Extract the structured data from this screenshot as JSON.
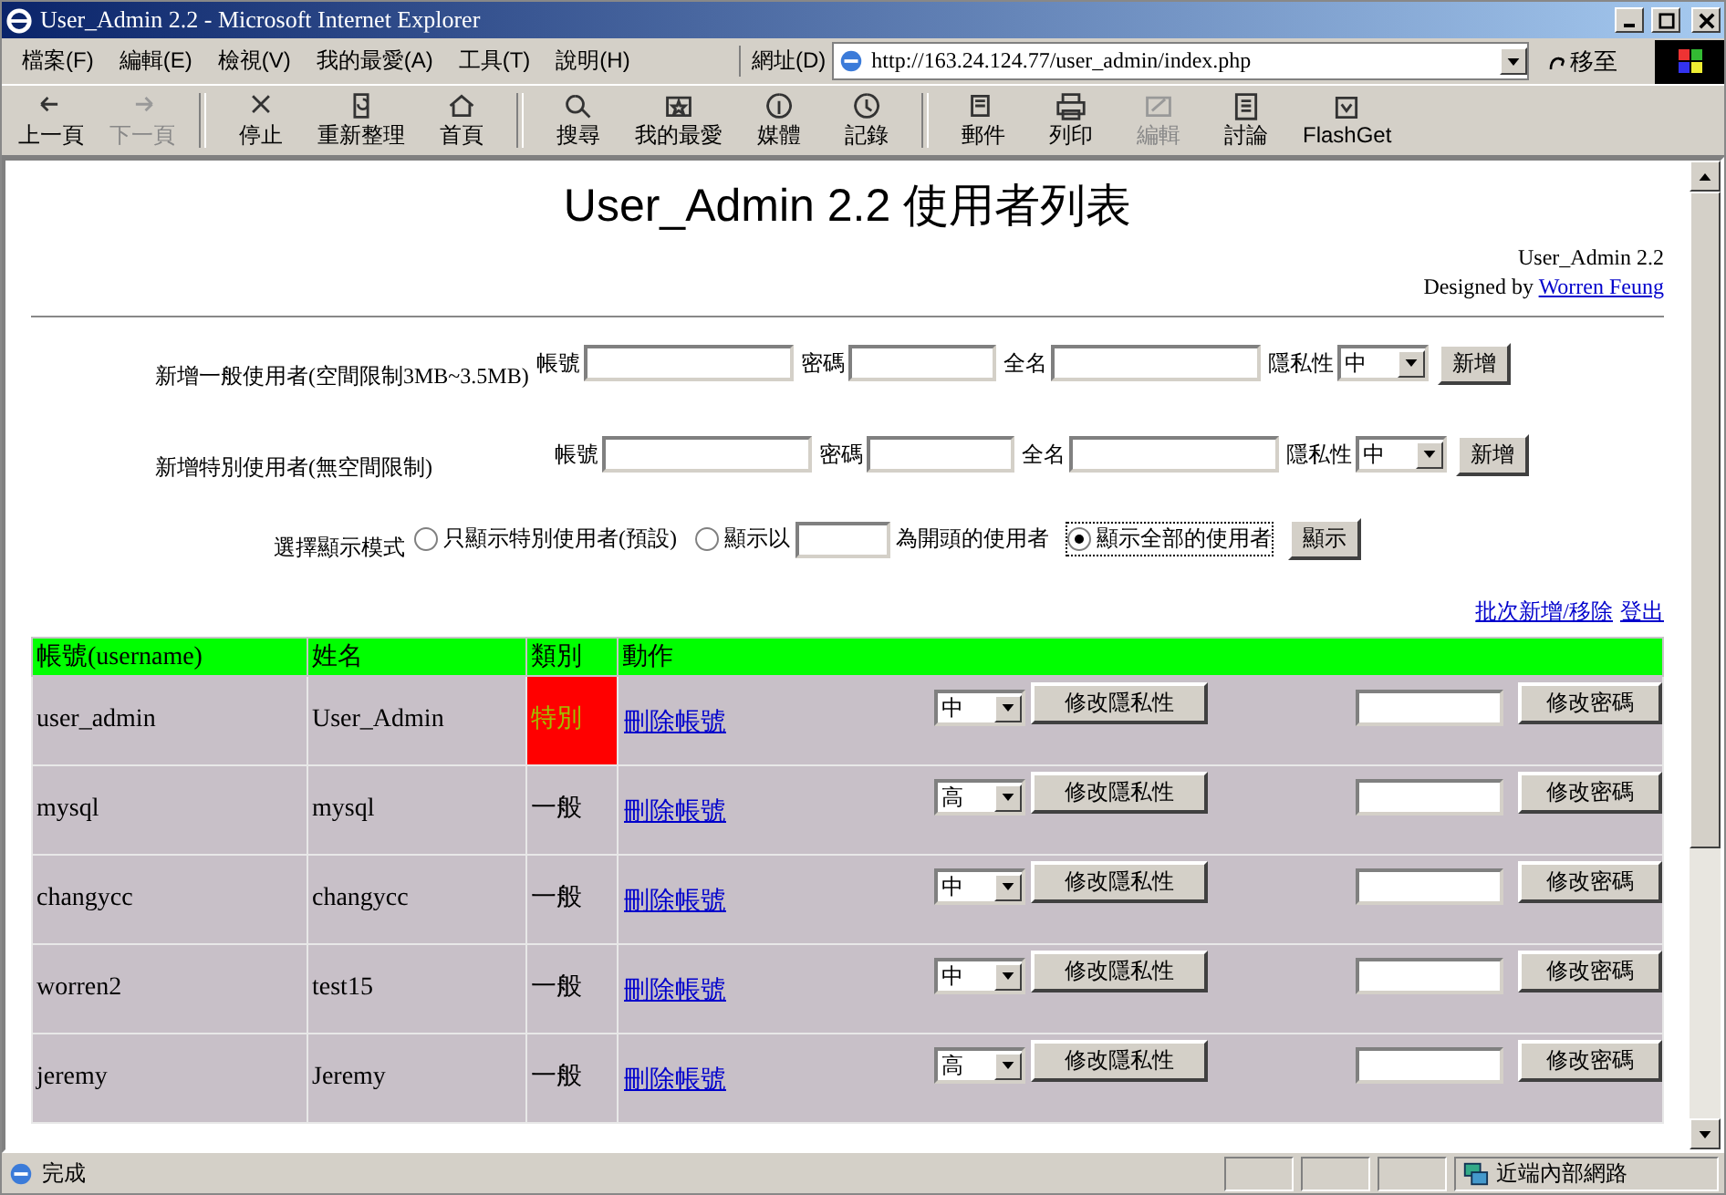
{
  "window": {
    "title": "User_Admin 2.2 - Microsoft Internet Explorer"
  },
  "menu": [
    "檔案(F)",
    "編輯(E)",
    "檢視(V)",
    "我的最愛(A)",
    "工具(T)",
    "說明(H)"
  ],
  "address": {
    "label": "網址(D)",
    "value": "http://163.24.124.77/user_admin/index.php",
    "go": "移至"
  },
  "toolbar": [
    {
      "kind": "back",
      "label": "上一頁",
      "disabled": false
    },
    {
      "kind": "forward",
      "label": "下一頁",
      "disabled": true
    },
    {
      "kind": "stop",
      "label": "停止",
      "disabled": false
    },
    {
      "kind": "refresh",
      "label": "重新整理",
      "disabled": false
    },
    {
      "kind": "home",
      "label": "首頁",
      "disabled": false
    },
    {
      "kind": "search",
      "label": "搜尋",
      "disabled": false
    },
    {
      "kind": "favorites",
      "label": "我的最愛",
      "disabled": false
    },
    {
      "kind": "media",
      "label": "媒體",
      "disabled": false
    },
    {
      "kind": "history",
      "label": "記錄",
      "disabled": false
    },
    {
      "kind": "mail",
      "label": "郵件",
      "disabled": false
    },
    {
      "kind": "print",
      "label": "列印",
      "disabled": false
    },
    {
      "kind": "edit",
      "label": "編輯",
      "disabled": true
    },
    {
      "kind": "discuss",
      "label": "討論",
      "disabled": false
    },
    {
      "kind": "flashget",
      "label": "FlashGet",
      "disabled": false
    }
  ],
  "page": {
    "title": "User_Admin 2.2 使用者列表",
    "credit_line": "User_Admin 2.2",
    "designed_by": "Designed by",
    "author_link": "Worren Feung",
    "add_forms": [
      {
        "label": "新增一般使用者(空間限制3MB~3.5MB)",
        "account_label": "帳號",
        "password_label": "密碼",
        "fullname_label": "全名",
        "privacy_label": "隱私性",
        "privacy_value": "中",
        "button": "新增"
      },
      {
        "label": "新增特別使用者(無空間限制)",
        "account_label": "帳號",
        "password_label": "密碼",
        "fullname_label": "全名",
        "privacy_label": "隱私性",
        "privacy_value": "中",
        "button": "新增"
      }
    ],
    "display_mode": {
      "label": "選擇顯示模式",
      "options": [
        {
          "kind": "plain",
          "label": "只顯示特別使用者(預設)",
          "selected": false
        },
        {
          "kind": "prefix",
          "label": "顯示以",
          "suffix": "為開頭的使用者",
          "selected": false
        },
        {
          "kind": "plain",
          "label": "顯示全部的使用者",
          "selected": true
        }
      ],
      "button": "顯示"
    },
    "links": [
      "批次新增/移除",
      "登出"
    ],
    "table": {
      "columns": [
        "帳號(username)",
        "姓名",
        "類別",
        "動作"
      ],
      "rows": [
        {
          "username": "user_admin",
          "name": "User_Admin",
          "category": "特別",
          "special": true,
          "action_link": "刪除帳號",
          "privacy": "中",
          "privacy_button": "修改隱私性",
          "password_button": "修改密碼"
        },
        {
          "username": "mysql",
          "name": "mysql",
          "category": "一般",
          "special": false,
          "action_link": "刪除帳號",
          "privacy": "高",
          "privacy_button": "修改隱私性",
          "password_button": "修改密碼"
        },
        {
          "username": "changycc",
          "name": "changycc",
          "category": "一般",
          "special": false,
          "action_link": "刪除帳號",
          "privacy": "中",
          "privacy_button": "修改隱私性",
          "password_button": "修改密碼"
        },
        {
          "username": "worren2",
          "name": "test15",
          "category": "一般",
          "special": false,
          "action_link": "刪除帳號",
          "privacy": "中",
          "privacy_button": "修改隱私性",
          "password_button": "修改密碼"
        },
        {
          "username": "jeremy",
          "name": "Jeremy",
          "category": "一般",
          "special": false,
          "action_link": "刪除帳號",
          "privacy": "高",
          "privacy_button": "修改隱私性",
          "password_button": "修改密碼"
        }
      ]
    }
  },
  "status_bar": {
    "text": "完成",
    "zone": "近端內部網路"
  }
}
